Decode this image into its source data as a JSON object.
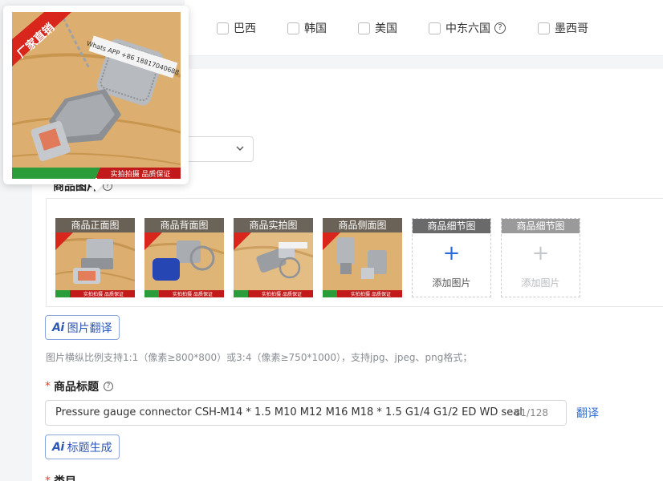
{
  "countries": [
    {
      "label": "巴西",
      "checked": false
    },
    {
      "label": "韩国",
      "checked": false
    },
    {
      "label": "美国",
      "checked": false
    },
    {
      "label": "中东六国",
      "checked": false,
      "has_help": true
    },
    {
      "label": "墨西哥",
      "checked": false
    }
  ],
  "help_glyph": "?",
  "images_section": {
    "label": "商品图片",
    "thumbnails": [
      {
        "label": "商品正面图",
        "stamp": "实拍拍摄 品质保证"
      },
      {
        "label": "商品背面图",
        "stamp": "实拍拍摄 品质保证"
      },
      {
        "label": "商品实拍图",
        "stamp": "实拍拍摄 品质保证"
      },
      {
        "label": "商品侧面图",
        "stamp": "实拍拍摄 品质保证"
      }
    ],
    "slots": [
      {
        "label": "商品细节图",
        "add_text": "添加图片",
        "disabled": false
      },
      {
        "label": "商品细节图",
        "add_text": "添加图片",
        "disabled": true
      }
    ],
    "plus_glyph": "+",
    "translate_button": "图片翻译",
    "hint": "图片横纵比例支持1:1（像素≥800*800）或3:4（像素≥750*1000），支持jpg、jpeg、png格式；"
  },
  "ai_mark": "Ai",
  "title_section": {
    "required_mark": "*",
    "label": "商品标题",
    "value": "Pressure gauge connector CSH-M14 * 1.5 M10 M12 M16 M18 * 1.5 G1/4 G1/2 ED WD seal",
    "counter": "81/128",
    "translate_link": "翻译",
    "generate_button": "标题生成"
  },
  "next_section": {
    "required_mark": "*",
    "label": "类目"
  },
  "popup": {
    "banner": "厂家直销",
    "phone_tag": "Whats APP +86 18817040688",
    "stamp": "实拍拍摄 品质保证"
  },
  "colors": {
    "accent": "#2c57b8",
    "link": "#2b6fd6",
    "required": "#e8412b",
    "banner_red": "#d8261d"
  }
}
